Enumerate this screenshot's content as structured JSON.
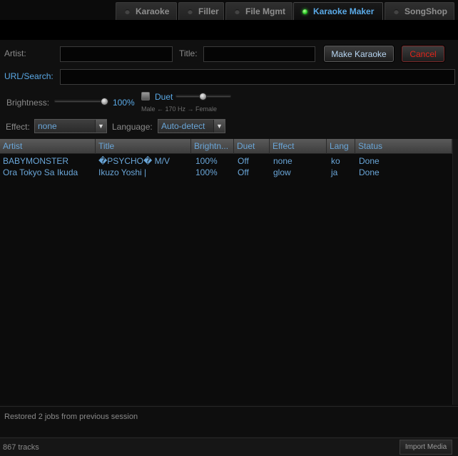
{
  "tabs": [
    {
      "label": "Karaoke",
      "active": false
    },
    {
      "label": "Filler",
      "active": false
    },
    {
      "label": "File Mgmt",
      "active": false
    },
    {
      "label": "Karaoke Maker",
      "active": true
    },
    {
      "label": "SongShop",
      "active": false
    }
  ],
  "form": {
    "artist_label": "Artist:",
    "artist_value": "",
    "title_label": "Title:",
    "title_value": "",
    "make_button": "Make Karaoke",
    "cancel_button": "Cancel",
    "url_label": "URL/Search:",
    "url_value": "",
    "brightness_label": "Brightness:",
    "brightness_value": "100%",
    "brightness_level": 1.0,
    "duet_label": "Duet",
    "duet_checked": false,
    "duet_level": 0.5,
    "duet_hint": "Male ← 170 Hz → Female",
    "effect_label": "Effect:",
    "effect_value": "none",
    "language_label": "Language:",
    "language_value": "Auto-detect"
  },
  "table": {
    "columns": [
      "Artist",
      "Title",
      "Brightn...",
      "Duet",
      "Effect",
      "Lang",
      "Status"
    ],
    "rows": [
      [
        "BABYMONSTER",
        "�PSYCHO� M/V",
        "100%",
        "Off",
        "none",
        "ko",
        "Done"
      ],
      [
        "Ora Tokyo Sa Ikuda",
        "Ikuzo Yoshi |",
        "100%",
        "Off",
        "glow",
        "ja",
        "Done"
      ]
    ]
  },
  "status": {
    "message": "Restored 2 jobs from previous session"
  },
  "footer": {
    "track_count": "867 tracks",
    "import_button": "Import Media"
  },
  "colors": {
    "accent": "#5aa9e6",
    "active_led": "#2fd12a",
    "cancel": "#e0251b"
  }
}
